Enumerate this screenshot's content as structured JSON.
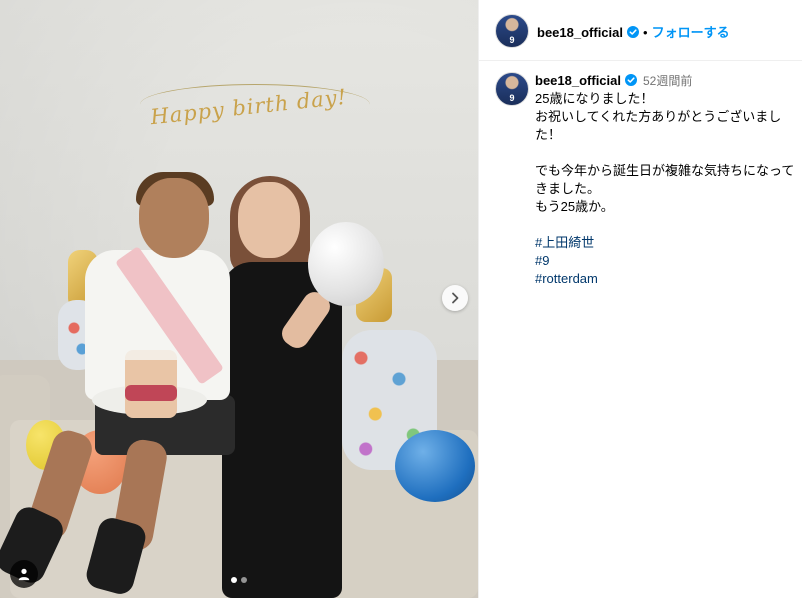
{
  "photo": {
    "banner_text": "Happy birth day!"
  },
  "colors": {
    "accent": "#0095f6",
    "hashtag": "#00376b",
    "verified": "#0095f6",
    "muted": "#737373"
  },
  "carousel": {
    "total_slides": 2,
    "active_slide": 1
  },
  "header": {
    "username": "bee18_official",
    "separator": "•",
    "follow_label": "フォローする",
    "avatar_number": "9"
  },
  "caption": {
    "username": "bee18_official",
    "time": "52週間前",
    "lines": [
      "25歳になりました！",
      "お祝いしてくれた方ありがとうございました！",
      "",
      "でも今年から誕生日が複雑な気持ちになってきました。",
      "もう25歳か。"
    ],
    "hashtags": [
      "#上田綺世",
      "#9",
      "#rotterdam"
    ]
  }
}
